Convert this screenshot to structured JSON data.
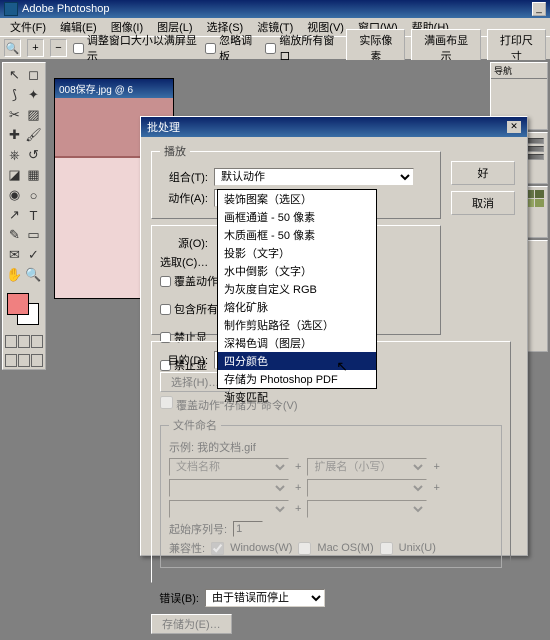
{
  "app": {
    "title": "Adobe Photoshop"
  },
  "menu": {
    "file": "文件(F)",
    "edit": "编辑(E)",
    "image": "图像(I)",
    "layer": "图层(L)",
    "select": "选择(S)",
    "filter": "滤镜(T)",
    "view": "视图(V)",
    "window": "窗口(W)",
    "help": "帮助(H)"
  },
  "options": {
    "fit_window": "调整窗口大小以满屏显示",
    "ignore_palettes": "忽略调板",
    "zoom_all": "缩放所有窗口",
    "actual_pixels": "实际像素",
    "fit_screen": "满画布显示",
    "print_size": "打印尺寸"
  },
  "doc": {
    "title": "008保存.jpg @ 6"
  },
  "right_panels": {
    "nav": "导航"
  },
  "dialog": {
    "title": "批处理",
    "ok": "好",
    "cancel": "取消",
    "play_group": "播放",
    "set_label": "组合(T):",
    "set_value": "默认动作",
    "action_label": "动作(A):",
    "action_value": "深褐色调（图层）",
    "dropdown_items": [
      "装饰图案（选区）",
      "画框通道 - 50 像素",
      "木质画框 - 50 像素",
      "投影（文字）",
      "水中倒影（文字）",
      "为灰度自定义 RGB",
      "熔化矿脉",
      "制作剪贴路径（选区）",
      "深褐色调（图层）",
      "四分颜色",
      "存储为 Photoshop PDF",
      "渐变匹配"
    ],
    "dropdown_selected_index": 9,
    "source_label": "源(O):",
    "select_btn": "选取(C)…",
    "override_open": "覆盖动作",
    "include_sub": "包含所有",
    "suppress_profile": "禁止显",
    "suppress_open": "禁止显",
    "dest_label": "目的(D):",
    "choose_btn": "选择(H)…",
    "override_save": "覆盖动作\"存储为\"命令(V)",
    "naming_group": "文件命名",
    "naming_example_label": "示例: 我的文档.gif",
    "doc_name": "文档名称",
    "ext_lower": "扩展名（小写）",
    "start_serial": "起始序列号:",
    "start_serial_value": "1",
    "compat_label": "兼容性:",
    "compat_win": "Windows(W)",
    "compat_mac": "Mac OS(M)",
    "compat_unix": "Unix(U)",
    "errors_label": "错误(B):",
    "errors_value": "由于错误而停止",
    "save_as_btn": "存储为(E)…"
  }
}
